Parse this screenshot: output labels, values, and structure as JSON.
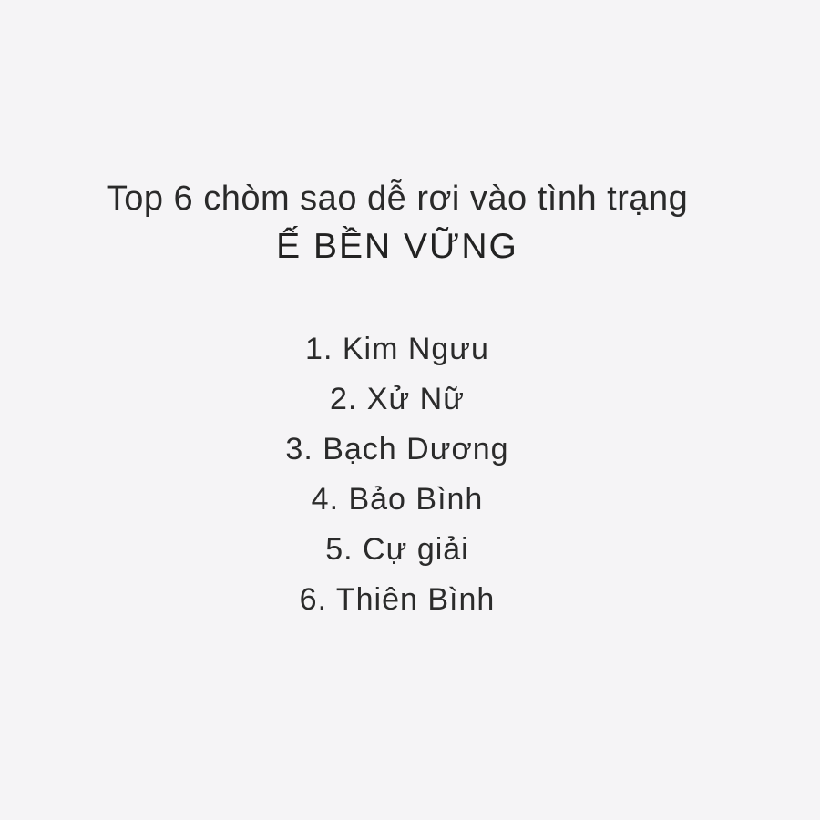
{
  "page": {
    "subtitle": "Top 6 chòm sao dễ rơi vào tình trạng",
    "headline": "Ế BỀN VỮNG"
  },
  "ranking": [
    "1. Kim Ngưu",
    "2. Xử Nữ",
    "3. Bạch Dương",
    "4. Bảo Bình",
    "5. Cự giải",
    "6. Thiên Bình"
  ],
  "colors": {
    "background": "#f5f4f6",
    "text": "#2b2b2b"
  }
}
